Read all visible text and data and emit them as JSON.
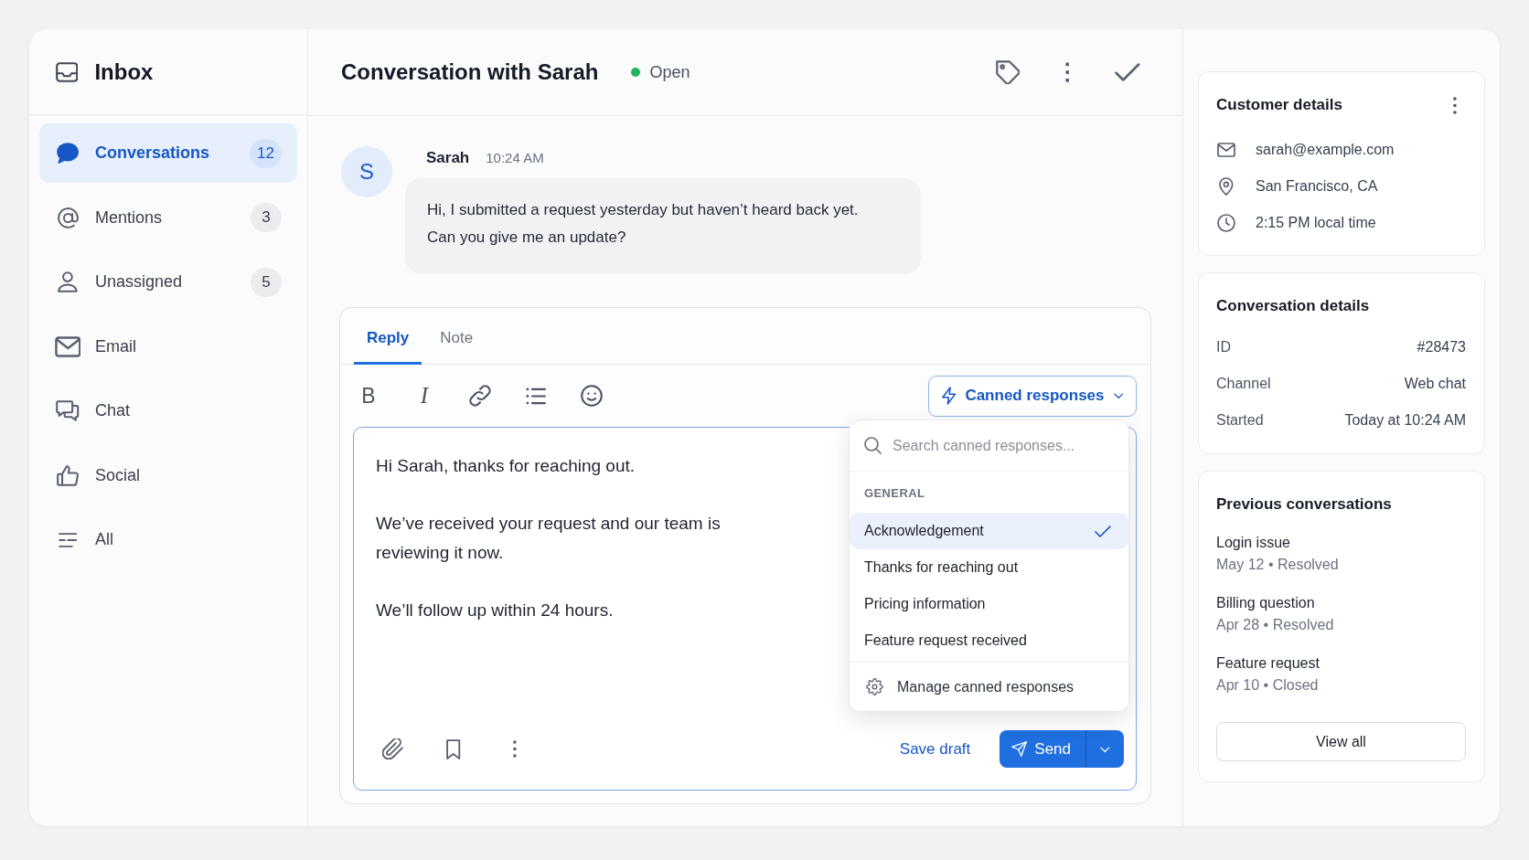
{
  "sidebar": {
    "title": "Inbox",
    "items": [
      {
        "label": "Conversations",
        "count": "12",
        "selected": true
      },
      {
        "label": "Mentions",
        "count": "3",
        "selected": false
      },
      {
        "label": "Unassigned",
        "count": "5",
        "selected": false
      },
      {
        "label": "Email",
        "selected": false
      },
      {
        "label": "Chat",
        "selected": false
      },
      {
        "label": "Social",
        "selected": false
      },
      {
        "label": "All",
        "selected": false
      }
    ]
  },
  "conversation": {
    "title": "Conversation with Sarah",
    "status": "Open"
  },
  "message": {
    "avatar": "S",
    "author": "Sarah",
    "time": "10:24 AM",
    "text": "Hi, I submitted a request yesterday but haven’t heard back yet.\nCan you give me an update?"
  },
  "composer": {
    "tabs": [
      {
        "label": "Reply",
        "selected": true
      },
      {
        "label": "Note",
        "selected": false
      }
    ],
    "toolbar": [
      {
        "kind": "bold",
        "label": "B"
      },
      {
        "kind": "italic",
        "label": "I"
      },
      {
        "kind": "link"
      },
      {
        "kind": "list"
      },
      {
        "kind": "emoji"
      }
    ],
    "canned_responses": {
      "label": "Canned responses",
      "expanded": true,
      "search": {
        "placeholder": "Search canned responses..."
      },
      "section": "GENERAL",
      "items": [
        {
          "label": "Acknowledgement",
          "selected": true
        },
        {
          "label": "Thanks for reaching out",
          "selected": false
        },
        {
          "label": "Pricing information",
          "selected": false
        },
        {
          "label": "Feature request received",
          "selected": false
        }
      ],
      "manage": "Manage canned responses"
    },
    "editor": {
      "value": "Hi Sarah, thanks for reaching out.\n\nWe’ve received your request and our team is\nreviewing it now.\n\nWe’ll follow up within 24 hours."
    },
    "save_draft": "Save draft",
    "send": "Send"
  },
  "customer_details": {
    "title": "Customer details",
    "rows": [
      {
        "kind": "email",
        "text": "sarah@example.com"
      },
      {
        "kind": "location",
        "text": "San Francisco, CA"
      },
      {
        "kind": "local_time",
        "text": "2:15 PM local time"
      }
    ]
  },
  "conversation_details": {
    "title": "Conversation details",
    "rows": [
      {
        "label": "ID",
        "value": "#28473"
      },
      {
        "label": "Channel",
        "value": "Web chat"
      },
      {
        "label": "Started",
        "value": "Today at 10:24 AM"
      }
    ]
  },
  "previous_conversations": {
    "title": "Previous conversations",
    "items": [
      {
        "title": "Login issue",
        "meta": "May 12 • Resolved"
      },
      {
        "title": "Billing question",
        "meta": "Apr 28 • Resolved"
      },
      {
        "title": "Feature request",
        "meta": "Apr 10 • Closed"
      }
    ],
    "button": "View all"
  }
}
